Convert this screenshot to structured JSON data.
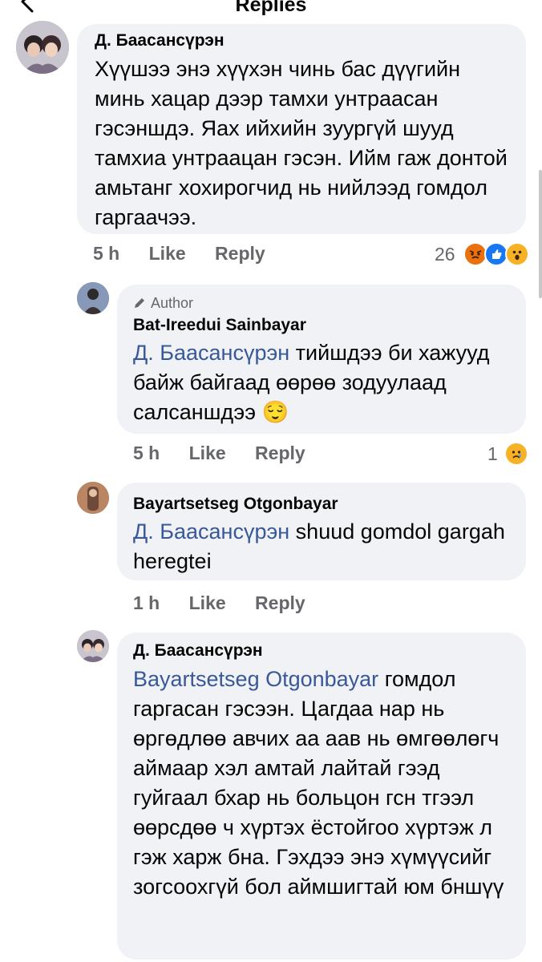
{
  "header": {
    "title": "Replies"
  },
  "comments": [
    {
      "author": "Д. Баасансүрэн",
      "text": "Хүүшээ энэ хүүхэн чинь бас дүүгийн минь  хацар дээр тамхи унтраасан гэсэншдэ. Яах ийхийн зуургүй шууд тамхиа унтраацан гэсэн. Ийм гаж донтой амьтанг хохирогчид нь нийлээд гомдол гаргаачээ.",
      "time": "5 h",
      "like": "Like",
      "reply": "Reply",
      "reaction_count": "26"
    },
    {
      "badge": "Author",
      "author": "Bat-Ireedui Sainbayar",
      "mention": "Д. Баасансүрэн",
      "text": " тийшдээ би хажууд байж байгаад өөрөө зодуулаад салсаншдээ",
      "emoji": "😌",
      "time": "5 h",
      "like": "Like",
      "reply": "Reply",
      "reaction_count": "1"
    },
    {
      "author": "Bayartsetseg Otgonbayar",
      "mention": "Д. Баасансүрэн",
      "text": " shuud gomdol gargah heregtei",
      "time": "1 h",
      "like": "Like",
      "reply": "Reply"
    },
    {
      "author": "Д. Баасансүрэн",
      "mention": "Bayartsetseg Otgonbayar",
      "text": " гомдол гаргасан гэсээн. Цагдаа нар нь өргөдлөө авчих аа аав нь өмгөөлөгч аймаар хэл амтай лайтай гээд гуйгаал бхар нь больцон гсн тгээл өөрсдөө ч хүртэх ёстойгоо хүртэж л гэж харж бна. Гэхдээ энэ хүмүүсийг зогсоохгүй бол аймшигтай юм бншүү"
    }
  ],
  "colors": {
    "mention": "#385898",
    "bubble": "#f0f2f5",
    "angry": "#e9710f",
    "like": "#1877f2",
    "wow": "#f7b125"
  },
  "icons": [
    "back-arrow-icon",
    "pencil-icon",
    "angry-reaction-icon",
    "like-reaction-icon",
    "wow-reaction-icon",
    "sad-reaction-icon"
  ]
}
